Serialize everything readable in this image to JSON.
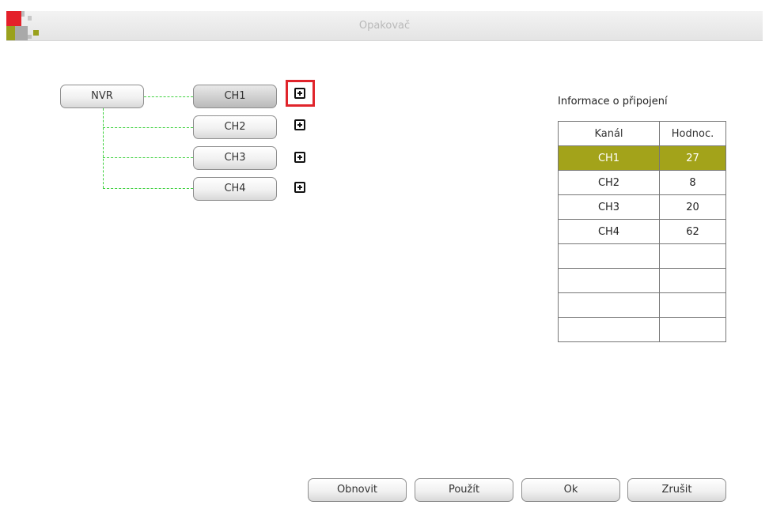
{
  "window": {
    "title": "Opakovač"
  },
  "logo": {
    "colors": [
      "#e4212a",
      "#aeaeae",
      "#9aa11d",
      "#c7c7c7"
    ]
  },
  "tree": {
    "root": "NVR",
    "channels": [
      {
        "label": "CH1",
        "selected": true
      },
      {
        "label": "CH2",
        "selected": false
      },
      {
        "label": "CH3",
        "selected": false
      },
      {
        "label": "CH4",
        "selected": false
      }
    ],
    "link_color": "#3fd13f"
  },
  "info": {
    "title": "Informace o připojení",
    "headers": [
      "Kanál",
      "Hodnoc."
    ],
    "rows": [
      {
        "channel": "CH1",
        "score": "27"
      },
      {
        "channel": "CH2",
        "score": "8"
      },
      {
        "channel": "CH3",
        "score": "20"
      },
      {
        "channel": "CH4",
        "score": "62"
      }
    ],
    "selected_color": "#a3a31a"
  },
  "footer": {
    "refresh": "Obnovit",
    "apply": "Použít",
    "ok": "Ok",
    "cancel": "Zrušit"
  }
}
